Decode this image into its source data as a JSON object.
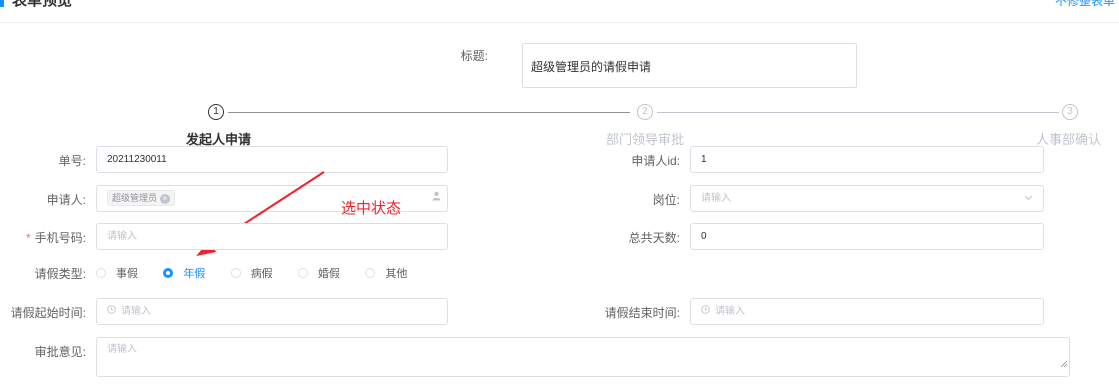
{
  "header": {
    "title": "表单预览",
    "action_link": "不修整表单"
  },
  "title_field": {
    "label": "标题:",
    "value": "超级管理员的请假申请"
  },
  "steps": [
    {
      "number": "1",
      "title": "发起人申请",
      "state": "active"
    },
    {
      "number": "2",
      "title": "部门领导审批",
      "state": "wait"
    },
    {
      "number": "3",
      "title": "人事部确认",
      "state": "wait"
    }
  ],
  "form": {
    "order_no": {
      "label": "单号:",
      "value": "20211230011"
    },
    "applicant_id": {
      "label": "申请人id:",
      "value": "1"
    },
    "applicant": {
      "label": "申请人:",
      "tag": "超级管理员",
      "tag_close": "×",
      "icon": "user-icon"
    },
    "position": {
      "label": "岗位:",
      "placeholder": "请输入",
      "icon": "chevron-down-icon"
    },
    "phone": {
      "label": "手机号码:",
      "required_mark": "*",
      "placeholder": "请输入"
    },
    "total_days": {
      "label": "总共天数:",
      "value": "0"
    },
    "leave_type": {
      "label": "请假类型:",
      "options": [
        "事假",
        "年假",
        "病假",
        "婚假",
        "其他"
      ],
      "selected": "年假"
    },
    "start_time": {
      "label": "请假起始时间:",
      "placeholder": "请输入",
      "icon": "clock-icon"
    },
    "end_time": {
      "label": "请假结束时间:",
      "placeholder": "请输入",
      "icon": "clock-icon"
    },
    "comment": {
      "label": "审批意见:",
      "placeholder": "请输入"
    }
  },
  "annotation": {
    "text": "选中状态",
    "color": "#f5222d"
  },
  "colors": {
    "accent": "#1890ff",
    "border": "#dcdfe6",
    "placeholder": "#c0c4cc"
  }
}
